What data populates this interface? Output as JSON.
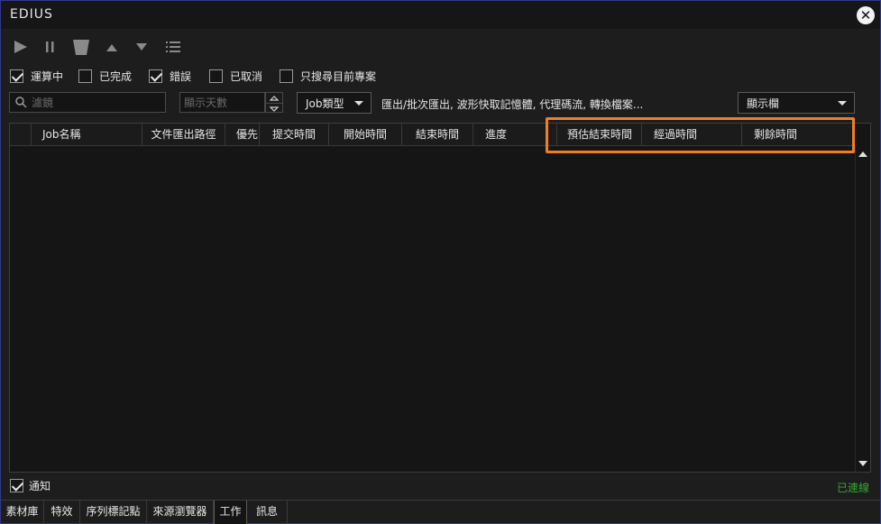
{
  "window": {
    "title": "EDIUS"
  },
  "filters": [
    {
      "label": "運算中",
      "checked": true
    },
    {
      "label": "已完成",
      "checked": false
    },
    {
      "label": "錯誤",
      "checked": true
    },
    {
      "label": "已取消",
      "checked": false
    },
    {
      "label": "只搜尋目前專案",
      "checked": false
    }
  ],
  "search": {
    "placeholder": "濾鏡",
    "value": ""
  },
  "days": {
    "placeholder": "顯示天數",
    "value": ""
  },
  "job_type": {
    "label": "Job類型"
  },
  "job_type_desc": "匯出/批次匯出, 波形快取記憶體, 代理碼流, 轉換檔案...",
  "columns_dropdown": {
    "label": "顯示欄"
  },
  "table": {
    "columns": [
      "Job名稱",
      "文件匯出路徑",
      "優先",
      "提交時間",
      "開始時間",
      "結束時間",
      "進度",
      "預估結束時間",
      "經過時間",
      "剩餘時間"
    ],
    "rows": []
  },
  "notify": {
    "label": "通知",
    "checked": true
  },
  "status": "已連線",
  "status_color": "#35a832",
  "highlight_color": "#f07f22",
  "tabs": [
    "素材庫",
    "特效",
    "序列標記點",
    "來源瀏覽器",
    "工作",
    "訊息"
  ],
  "active_tab": "工作",
  "toolbar_icons": [
    "play-icon",
    "pause-icon",
    "delete-icon",
    "move-up-icon",
    "move-down-icon",
    "list-icon"
  ]
}
